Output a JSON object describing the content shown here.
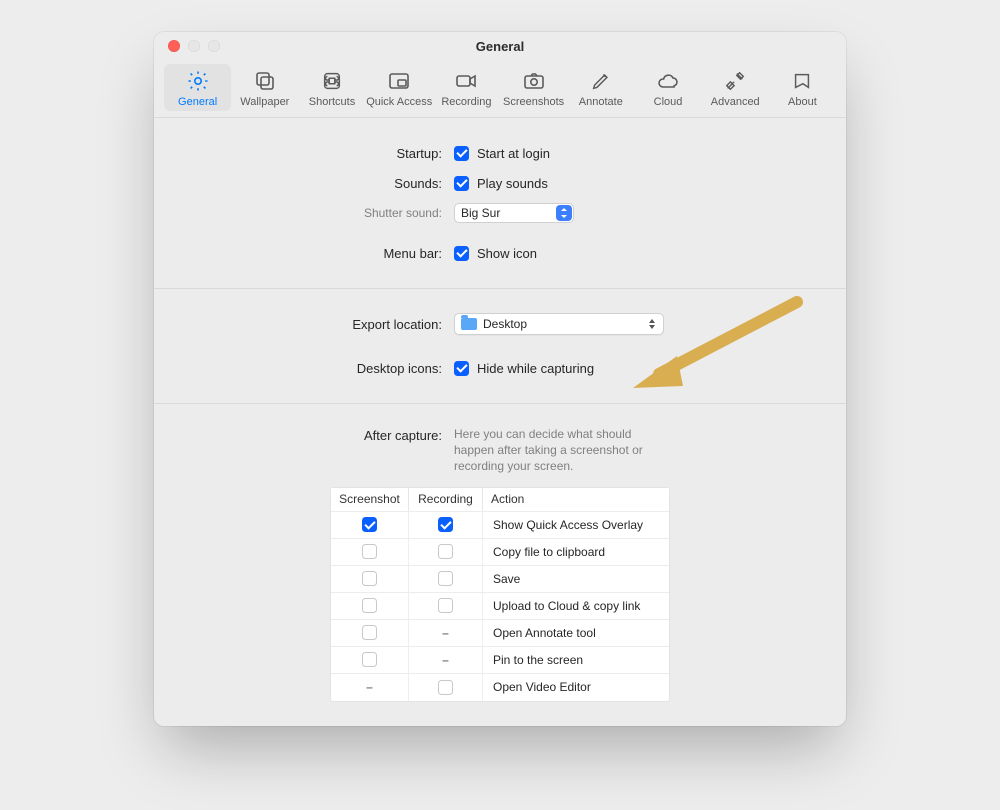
{
  "window": {
    "title": "General"
  },
  "tabs": [
    {
      "id": "general",
      "label": "General"
    },
    {
      "id": "wallpaper",
      "label": "Wallpaper"
    },
    {
      "id": "shortcuts",
      "label": "Shortcuts"
    },
    {
      "id": "quickaccess",
      "label": "Quick Access"
    },
    {
      "id": "recording",
      "label": "Recording"
    },
    {
      "id": "screenshots",
      "label": "Screenshots"
    },
    {
      "id": "annotate",
      "label": "Annotate"
    },
    {
      "id": "cloud",
      "label": "Cloud"
    },
    {
      "id": "advanced",
      "label": "Advanced"
    },
    {
      "id": "about",
      "label": "About"
    }
  ],
  "labels": {
    "startup": "Startup:",
    "sounds": "Sounds:",
    "shutter": "Shutter sound:",
    "menubar": "Menu bar:",
    "export": "Export location:",
    "desktop": "Desktop icons:",
    "after": "After capture:"
  },
  "checks": {
    "startup": "Start at login",
    "sounds": "Play sounds",
    "menubar": "Show icon",
    "desktop": "Hide while capturing"
  },
  "selects": {
    "shutter": "Big Sur",
    "export": "Desktop"
  },
  "after_desc": "Here you can decide what should happen after taking a screenshot or recording your screen.",
  "table": {
    "headers": {
      "c1": "Screenshot",
      "c2": "Recording",
      "c3": "Action"
    },
    "rows": [
      {
        "screenshot": "on",
        "recording": "on",
        "action": "Show Quick Access Overlay"
      },
      {
        "screenshot": "off",
        "recording": "off",
        "action": "Copy file to clipboard"
      },
      {
        "screenshot": "off",
        "recording": "off",
        "action": "Save"
      },
      {
        "screenshot": "off",
        "recording": "off",
        "action": "Upload to Cloud & copy link"
      },
      {
        "screenshot": "off",
        "recording": "dash",
        "action": "Open Annotate tool"
      },
      {
        "screenshot": "off",
        "recording": "dash",
        "action": "Pin to the screen"
      },
      {
        "screenshot": "dash",
        "recording": "off",
        "action": "Open Video Editor"
      }
    ]
  }
}
